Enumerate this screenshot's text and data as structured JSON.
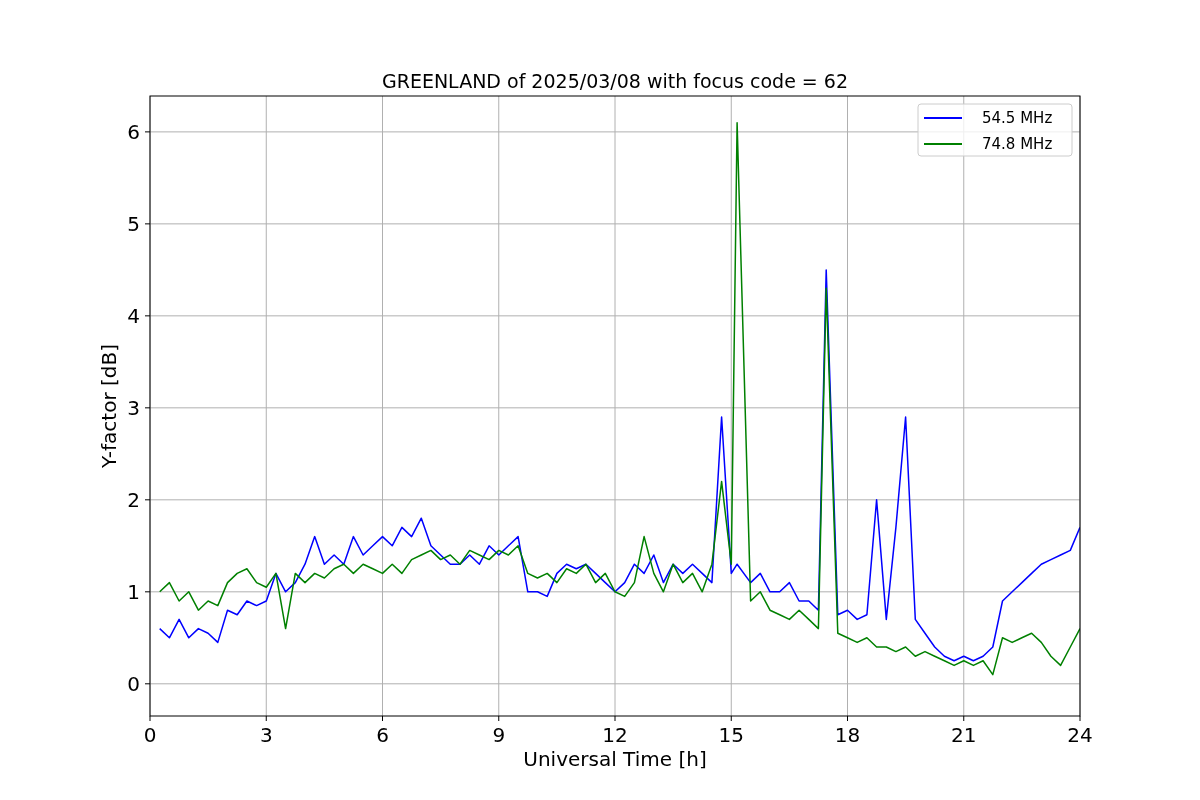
{
  "figure": {
    "chart_data": {
      "type": "line",
      "title": "GREENLAND of 2025/03/08 with focus code = 62",
      "xlabel": "Universal Time [h]",
      "ylabel": "Y-factor [dB]",
      "x": [
        0.25,
        0.5,
        0.75,
        1,
        1.25,
        1.5,
        1.75,
        2,
        2.25,
        2.5,
        2.75,
        3,
        3.25,
        3.5,
        3.75,
        4,
        4.25,
        4.5,
        4.75,
        5,
        5.25,
        5.5,
        5.75,
        6,
        6.25,
        6.5,
        6.75,
        7,
        7.25,
        7.5,
        7.75,
        8,
        8.25,
        8.5,
        8.75,
        9,
        9.25,
        9.5,
        9.75,
        10,
        10.25,
        10.5,
        10.75,
        11,
        11.25,
        11.5,
        11.75,
        12,
        12.25,
        12.5,
        12.75,
        13,
        13.25,
        13.5,
        13.75,
        14,
        14.25,
        14.5,
        14.75,
        15,
        15.15,
        15.5,
        15.75,
        16,
        16.25,
        16.5,
        16.75,
        17,
        17.25,
        17.45,
        17.75,
        18,
        18.25,
        18.5,
        18.75,
        19,
        19.25,
        19.5,
        19.75,
        20,
        20.25,
        20.5,
        20.75,
        21,
        21.25,
        21.5,
        21.75,
        22,
        22.25,
        22.5,
        22.75,
        23,
        23.25,
        23.5,
        23.75,
        24
      ],
      "series": [
        {
          "name": "54.5 MHz",
          "color": "#0000ff",
          "values": [
            0.6,
            0.5,
            0.7,
            0.5,
            0.6,
            0.55,
            0.45,
            0.8,
            0.75,
            0.9,
            0.85,
            0.9,
            1.2,
            1.0,
            1.1,
            1.3,
            1.6,
            1.3,
            1.4,
            1.3,
            1.6,
            1.4,
            1.5,
            1.6,
            1.5,
            1.7,
            1.6,
            1.8,
            1.5,
            1.4,
            1.3,
            1.3,
            1.4,
            1.3,
            1.5,
            1.4,
            1.5,
            1.6,
            1.0,
            1.0,
            0.95,
            1.2,
            1.3,
            1.25,
            1.3,
            1.2,
            1.1,
            1.0,
            1.1,
            1.3,
            1.2,
            1.4,
            1.1,
            1.3,
            1.2,
            1.3,
            1.2,
            1.1,
            2.9,
            1.2,
            1.3,
            1.1,
            1.2,
            1.0,
            1.0,
            1.1,
            0.9,
            0.9,
            0.8,
            4.5,
            0.75,
            0.8,
            0.7,
            0.75,
            2.0,
            0.7,
            1.7,
            2.9,
            0.7,
            0.55,
            0.4,
            0.3,
            0.25,
            0.3,
            0.25,
            0.3,
            0.4,
            0.9,
            1.0,
            1.1,
            1.2,
            1.3,
            1.35,
            1.4,
            1.45,
            1.7
          ]
        },
        {
          "name": "74.8 MHz",
          "color": "#008000",
          "values": [
            1.0,
            1.1,
            0.9,
            1.0,
            0.8,
            0.9,
            0.85,
            1.1,
            1.2,
            1.25,
            1.1,
            1.05,
            1.2,
            0.6,
            1.2,
            1.1,
            1.2,
            1.15,
            1.25,
            1.3,
            1.2,
            1.3,
            1.25,
            1.2,
            1.3,
            1.2,
            1.35,
            1.4,
            1.45,
            1.35,
            1.4,
            1.3,
            1.45,
            1.4,
            1.35,
            1.45,
            1.4,
            1.5,
            1.2,
            1.15,
            1.2,
            1.1,
            1.25,
            1.2,
            1.3,
            1.1,
            1.2,
            1.0,
            0.95,
            1.1,
            1.6,
            1.2,
            1.0,
            1.3,
            1.1,
            1.2,
            1.0,
            1.3,
            2.2,
            1.3,
            6.1,
            0.9,
            1.0,
            0.8,
            0.75,
            0.7,
            0.8,
            0.7,
            0.6,
            4.3,
            0.55,
            0.5,
            0.45,
            0.5,
            0.4,
            0.4,
            0.35,
            0.4,
            0.3,
            0.35,
            0.3,
            0.25,
            0.2,
            0.25,
            0.2,
            0.25,
            0.1,
            0.5,
            0.45,
            0.5,
            0.55,
            0.45,
            0.3,
            0.2,
            0.4,
            0.6
          ]
        }
      ],
      "grid": true,
      "legend": true,
      "xlim": [
        0,
        24
      ],
      "ylim": [
        -0.35,
        6.39
      ],
      "xticks": [
        0,
        3,
        6,
        9,
        12,
        15,
        18,
        21,
        24
      ],
      "yticks": [
        0,
        1,
        2,
        3,
        4,
        5,
        6
      ]
    }
  }
}
